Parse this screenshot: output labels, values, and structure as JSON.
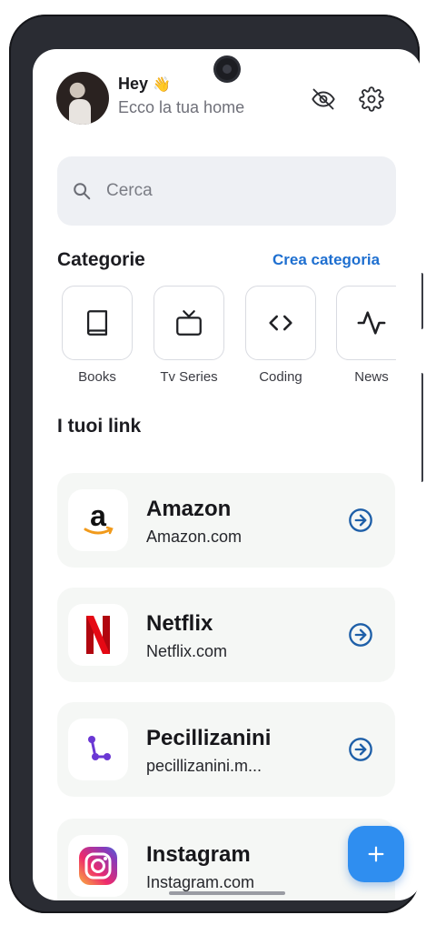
{
  "header": {
    "greeting": "Hey",
    "greeting_emoji": "👋",
    "subtitle": "Ecco la tua home",
    "icons": [
      "eye-off-icon",
      "gear-icon"
    ]
  },
  "search": {
    "placeholder": "Cerca"
  },
  "categories": {
    "title": "Categorie",
    "action": "Crea categoria",
    "items": [
      {
        "label": "Books",
        "icon": "book-icon"
      },
      {
        "label": "Tv Series",
        "icon": "tv-icon"
      },
      {
        "label": "Coding",
        "icon": "code-icon"
      },
      {
        "label": "News",
        "icon": "activity-icon"
      }
    ]
  },
  "links": {
    "title": "I tuoi link",
    "items": [
      {
        "name": "Amazon",
        "url": "Amazon.com",
        "icon": "amazon-logo-icon"
      },
      {
        "name": "Netflix",
        "url": "Netflix.com",
        "icon": "netflix-logo-icon"
      },
      {
        "name": "Pecillizanini",
        "url": "pecillizanini.m...",
        "icon": "pecillizanini-logo-icon"
      },
      {
        "name": "Instagram",
        "url": "Instagram.com",
        "icon": "instagram-logo-icon"
      }
    ]
  },
  "colors": {
    "accent": "#1e6fd0",
    "fab": "#2f8ef0",
    "card_bg": "#f5f7f5",
    "search_bg": "#eef0f4"
  }
}
